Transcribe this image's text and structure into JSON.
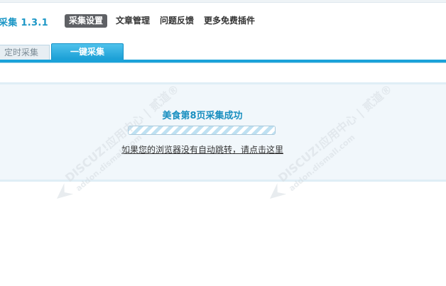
{
  "header": {
    "plugin_title": "采集 1.3.1",
    "nav": [
      {
        "label": "采集设置",
        "active": true
      },
      {
        "label": "文章管理",
        "active": false
      },
      {
        "label": "问题反馈",
        "active": false
      },
      {
        "label": "更多免费插件",
        "active": false
      }
    ]
  },
  "tabs": {
    "timed": "定时采集",
    "oneclick": "一键采集"
  },
  "status": {
    "message": "美食第8页采集成功",
    "progress_fraction": 1.0,
    "redirect_text": "如果您的浏览器没有自动跳转，请点击这里"
  },
  "watermark": {
    "line1": "DISCUZ!应用中心 | 贰道®",
    "line2": "addon.dismall.com"
  },
  "colors": {
    "accent": "#1aa2d9",
    "title": "#1d97c6",
    "panel_bg": "#f1f7fb"
  }
}
